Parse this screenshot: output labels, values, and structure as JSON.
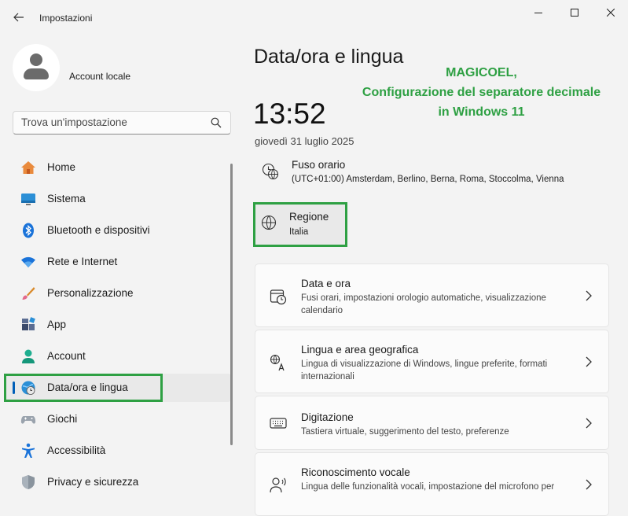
{
  "window": {
    "title": "Impostazioni"
  },
  "account": {
    "name": "Account locale"
  },
  "search": {
    "placeholder": "Trova un'impostazione"
  },
  "nav": {
    "items": [
      {
        "label": "Home",
        "icon": "home-icon"
      },
      {
        "label": "Sistema",
        "icon": "system-icon"
      },
      {
        "label": "Bluetooth e dispositivi",
        "icon": "bluetooth-icon"
      },
      {
        "label": "Rete e Internet",
        "icon": "wifi-icon"
      },
      {
        "label": "Personalizzazione",
        "icon": "brush-icon"
      },
      {
        "label": "App",
        "icon": "apps-icon"
      },
      {
        "label": "Account",
        "icon": "account-icon"
      },
      {
        "label": "Data/ora e lingua",
        "icon": "time-language-icon",
        "selected": true
      },
      {
        "label": "Giochi",
        "icon": "gamepad-icon"
      },
      {
        "label": "Accessibilità",
        "icon": "accessibility-icon"
      },
      {
        "label": "Privacy e sicurezza",
        "icon": "shield-icon"
      }
    ]
  },
  "main": {
    "title": "Data/ora e lingua",
    "time": "13:52",
    "date": "giovedì 31 luglio 2025",
    "timezone": {
      "title": "Fuso orario",
      "value": "(UTC+01:00) Amsterdam, Berlino, Berna, Roma, Stoccolma, Vienna"
    },
    "region": {
      "title": "Regione",
      "value": "Italia"
    },
    "cards": [
      {
        "title": "Data e ora",
        "description": "Fusi orari, impostazioni orologio automatiche, visualizzazione calendario",
        "icon": "calendar-clock-icon"
      },
      {
        "title": "Lingua e area geografica",
        "description": "Lingua di visualizzazione di Windows, lingue preferite, formati internazionali",
        "icon": "language-icon"
      },
      {
        "title": "Digitazione",
        "description": "Tastiera virtuale, suggerimento del testo, preferenze",
        "icon": "keyboard-icon"
      },
      {
        "title": "Riconoscimento vocale",
        "description": "Lingua delle funzionalità vocali, impostazione del microfono per",
        "icon": "speech-icon"
      }
    ]
  },
  "annotation": {
    "line1": "MAGICOEL,",
    "line2": "Configurazione del separatore decimale",
    "line3": "in Windows 11",
    "color": "#2ea043"
  },
  "colors": {
    "accent": "#005fb8",
    "highlight": "#2ea043",
    "background": "#f3f3f3"
  }
}
